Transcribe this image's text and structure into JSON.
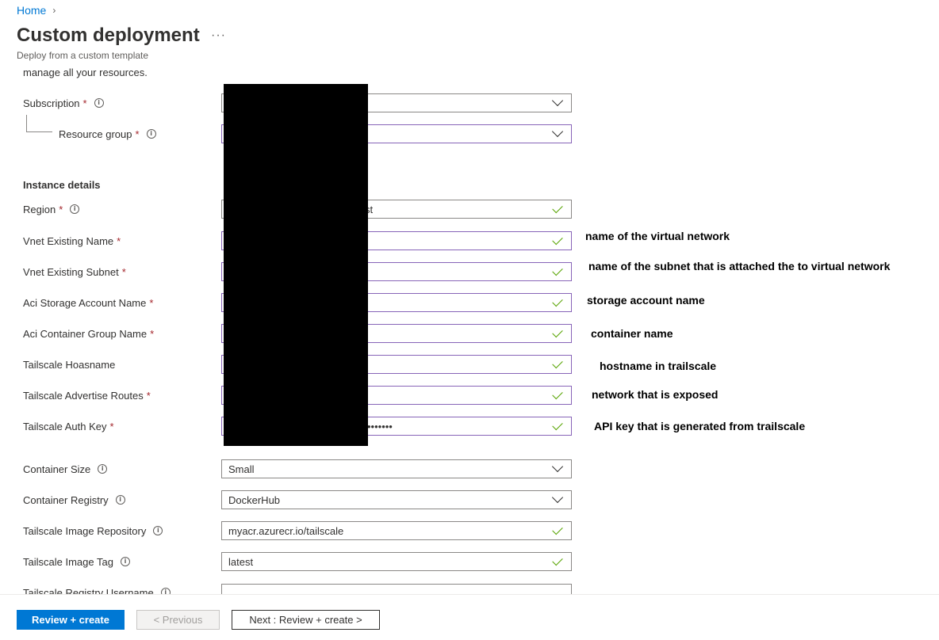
{
  "breadcrumb": {
    "home": "Home",
    "sep": "›"
  },
  "header": {
    "title": "Custom deployment",
    "more": "···",
    "subtitle": "Deploy from a custom template"
  },
  "intro_text": "manage all your resources.",
  "project": {
    "subscription_label": "Subscription",
    "resource_group_label": "Resource group"
  },
  "instance": {
    "heading": "Instance details",
    "region_label": "Region",
    "region_value_tail": "st",
    "vnet_name_label": "Vnet Existing Name",
    "vnet_subnet_label": "Vnet Existing Subnet",
    "storage_label": "Aci Storage Account Name",
    "container_group_label": "Aci Container Group Name",
    "hostname_label": "Tailscale Hoasname",
    "routes_label": "Tailscale Advertise Routes",
    "auth_key_label": "Tailscale Auth Key",
    "auth_key_value_tail": "•••••••",
    "container_size_label": "Container Size",
    "container_size_value": "Small",
    "registry_label": "Container Registry",
    "registry_value": "DockerHub",
    "image_repo_label": "Tailscale Image Repository",
    "image_repo_value": "myacr.azurecr.io/tailscale",
    "image_tag_label": "Tailscale Image Tag",
    "image_tag_value": "latest",
    "registry_username_label": "Tailscale Registry Username"
  },
  "required_mark": "*",
  "info_glyph": "i",
  "annotations": {
    "vnet_name": "name of the virtual network",
    "vnet_subnet": "name of the subnet that is attached the to virtual network",
    "storage": "storage account name",
    "container": "container name",
    "hostname": "hostname in trailscale",
    "routes": "network that is exposed",
    "auth_key": "API key that is generated from trailscale"
  },
  "footer": {
    "review_create": "Review + create",
    "previous": "< Previous",
    "next": "Next : Review + create >"
  },
  "colors": {
    "accent": "#0078d4",
    "required": "#a4262c",
    "valid": "#57a300",
    "focus": "#8764b8"
  }
}
